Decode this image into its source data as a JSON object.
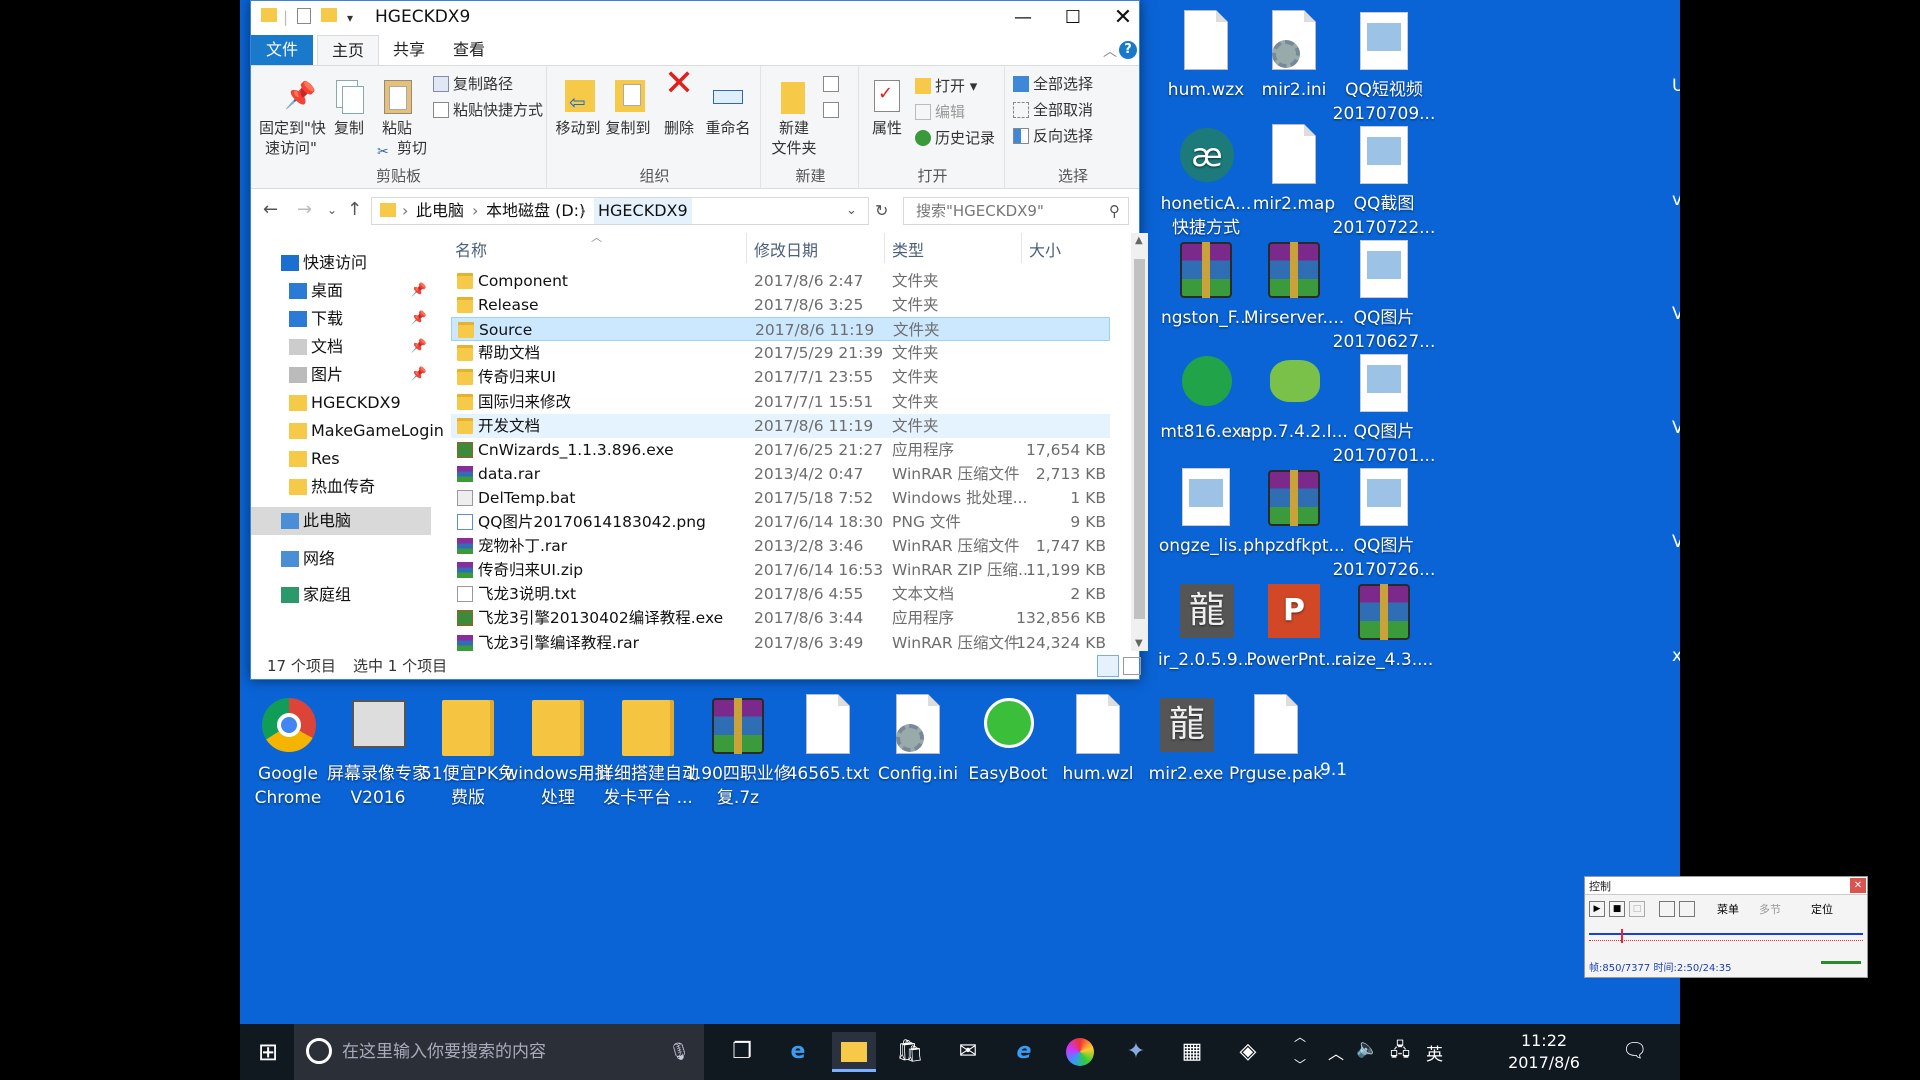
{
  "desktop_icons": [
    {
      "label": "hum.wzx",
      "icon": "file-icon"
    },
    {
      "label": "mir2.ini",
      "icon": "settings-file-icon"
    },
    {
      "label": "QQ短视频\n20170709...",
      "icon": "video-file-icon"
    },
    {
      "label": "honeticA...\n快捷方式",
      "icon": "app-shortcut-icon"
    },
    {
      "label": "mir2.map",
      "icon": "file-icon"
    },
    {
      "label": "QQ截图\n20170722...",
      "icon": "image-file-icon"
    },
    {
      "label": "ngston_F...",
      "icon": "rar-icon"
    },
    {
      "label": "Mirserver....",
      "icon": "rar-icon"
    },
    {
      "label": "QQ图片\n20170627...",
      "icon": "image-file-icon"
    },
    {
      "label": "mt816.exe",
      "icon": "installer-icon"
    },
    {
      "label": "npp.7.4.2.I...",
      "icon": "notepadpp-icon"
    },
    {
      "label": "QQ图片\n20170701...",
      "icon": "image-file-icon"
    },
    {
      "label": "ongze_lis...",
      "icon": "image-file-icon"
    },
    {
      "label": "phpzdfkpt...",
      "icon": "rar-icon"
    },
    {
      "label": "QQ图片\n20170726...",
      "icon": "image-file-icon"
    },
    {
      "label": "ir_2.0.5.9...",
      "icon": "app-icon"
    },
    {
      "label": "PowerPnt...",
      "icon": "powerpoint-icon"
    },
    {
      "label": "raize_4.3....",
      "icon": "rar-icon"
    },
    {
      "label": "Google\nChrome",
      "icon": "chrome-icon"
    },
    {
      "label": "屏幕录像专家\nV2016",
      "icon": "recorder-icon"
    },
    {
      "label": "51便宜PK免\n费版",
      "icon": "folder-icon"
    },
    {
      "label": "windows用批\n处理",
      "icon": "folder-icon"
    },
    {
      "label": "详细搭建自动\n发卡平台 ...",
      "icon": "folder-icon"
    },
    {
      "label": "1.90四职业修\n复.7z",
      "icon": "rar-icon"
    },
    {
      "label": "46565.txt",
      "icon": "text-file-icon"
    },
    {
      "label": "Config.ini",
      "icon": "settings-file-icon"
    },
    {
      "label": "EasyBoot",
      "icon": "easyboot-icon"
    },
    {
      "label": "hum.wzl",
      "icon": "file-icon"
    },
    {
      "label": "mir2.exe",
      "icon": "app-icon"
    },
    {
      "label": "Prguse.pak",
      "icon": "file-icon"
    }
  ],
  "edge_fragments": [
    "U",
    "vi",
    "V",
    "V",
    "V",
    "x",
    "9.1"
  ],
  "explorer": {
    "title": "HGECKDX9",
    "tabs": [
      "文件",
      "主页",
      "共享",
      "查看"
    ],
    "ribbon": {
      "clipboard": {
        "label": "剪贴板",
        "pin": "固定到\"快\n速访问\"",
        "copy": "复制",
        "paste": "粘贴",
        "copy_path": "复制路径",
        "paste_shortcut": "粘贴快捷方式",
        "cut": "剪切"
      },
      "organize": {
        "label": "组织",
        "move_to": "移动到",
        "copy_to": "复制到",
        "delete": "删除",
        "rename": "重命名"
      },
      "new": {
        "label": "新建",
        "new_folder": "新建\n文件夹"
      },
      "open": {
        "label": "打开",
        "properties": "属性",
        "open": "打开",
        "edit": "编辑",
        "history": "历史记录"
      },
      "select": {
        "label": "选择",
        "select_all": "全部选择",
        "select_none": "全部取消",
        "invert": "反向选择"
      }
    },
    "address": {
      "segments": [
        "此电脑",
        "本地磁盘 (D:)",
        "HGECKDX9"
      ],
      "search_placeholder": "搜索\"HGECKDX9\""
    },
    "nav": [
      {
        "label": "快速访问",
        "icon": "star-icon"
      },
      {
        "label": "桌面",
        "icon": "desktop-icon",
        "pinned": true
      },
      {
        "label": "下载",
        "icon": "download-icon",
        "pinned": true
      },
      {
        "label": "文档",
        "icon": "document-icon",
        "pinned": true
      },
      {
        "label": "图片",
        "icon": "pictures-icon",
        "pinned": true
      },
      {
        "label": "HGECKDX9",
        "icon": "folder-icon"
      },
      {
        "label": "MakeGameLogin",
        "icon": "folder-icon"
      },
      {
        "label": "Res",
        "icon": "folder-icon"
      },
      {
        "label": "热血传奇",
        "icon": "folder-icon"
      },
      {
        "label": "此电脑",
        "icon": "computer-icon"
      },
      {
        "label": "网络",
        "icon": "network-icon"
      },
      {
        "label": "家庭组",
        "icon": "homegroup-icon"
      }
    ],
    "columns": [
      "名称",
      "修改日期",
      "类型",
      "大小"
    ],
    "files": [
      {
        "name": "Component",
        "date": "2017/8/6 2:47",
        "type": "文件夹",
        "size": "",
        "icon": "folder"
      },
      {
        "name": "Release",
        "date": "2017/8/6 3:25",
        "type": "文件夹",
        "size": "",
        "icon": "folder"
      },
      {
        "name": "Source",
        "date": "2017/8/6 11:19",
        "type": "文件夹",
        "size": "",
        "icon": "folder"
      },
      {
        "name": "帮助文档",
        "date": "2017/5/29 21:39",
        "type": "文件夹",
        "size": "",
        "icon": "folder"
      },
      {
        "name": "传奇归来UI",
        "date": "2017/7/1 23:55",
        "type": "文件夹",
        "size": "",
        "icon": "folder"
      },
      {
        "name": "国际归来修改",
        "date": "2017/7/1 15:51",
        "type": "文件夹",
        "size": "",
        "icon": "folder"
      },
      {
        "name": "开发文档",
        "date": "2017/8/6 11:19",
        "type": "文件夹",
        "size": "",
        "icon": "folder"
      },
      {
        "name": "CnWizards_1.1.3.896.exe",
        "date": "2017/6/25 21:27",
        "type": "应用程序",
        "size": "17,654 KB",
        "icon": "exe"
      },
      {
        "name": "data.rar",
        "date": "2013/4/2 0:47",
        "type": "WinRAR 压缩文件",
        "size": "2,713 KB",
        "icon": "rar"
      },
      {
        "name": "DelTemp.bat",
        "date": "2017/5/18 7:52",
        "type": "Windows 批处理...",
        "size": "1 KB",
        "icon": "bat"
      },
      {
        "name": "QQ图片20170614183042.png",
        "date": "2017/6/14 18:30",
        "type": "PNG 文件",
        "size": "9 KB",
        "icon": "png"
      },
      {
        "name": "宠物补丁.rar",
        "date": "2013/2/8 3:46",
        "type": "WinRAR 压缩文件",
        "size": "1,747 KB",
        "icon": "rar"
      },
      {
        "name": "传奇归来UI.zip",
        "date": "2017/6/14 16:53",
        "type": "WinRAR ZIP 压缩...",
        "size": "11,199 KB",
        "icon": "rar"
      },
      {
        "name": "飞龙3说明.txt",
        "date": "2017/8/6 4:55",
        "type": "文本文档",
        "size": "2 KB",
        "icon": "txt"
      },
      {
        "name": "飞龙3引擎20130402编译教程.exe",
        "date": "2017/8/6 3:44",
        "type": "应用程序",
        "size": "132,856 KB",
        "icon": "exe"
      },
      {
        "name": "飞龙3引擎编译教程.rar",
        "date": "2017/8/6 3:49",
        "type": "WinRAR 压缩文件",
        "size": "124,324 KB",
        "icon": "rar"
      }
    ],
    "status": {
      "count": "17 个项目",
      "selected": "选中 1 个项目"
    }
  },
  "taskbar": {
    "search_placeholder": "在这里输入你要搜索的内容",
    "ime": "英",
    "time": "11:22",
    "date": "2017/8/6"
  },
  "control_widget": {
    "title": "控制",
    "menu": "菜单",
    "multi": "多节",
    "locate": "定位",
    "frame_text": "帧:850/7377 时间:2:50/24:35",
    "progress": 0.115
  }
}
